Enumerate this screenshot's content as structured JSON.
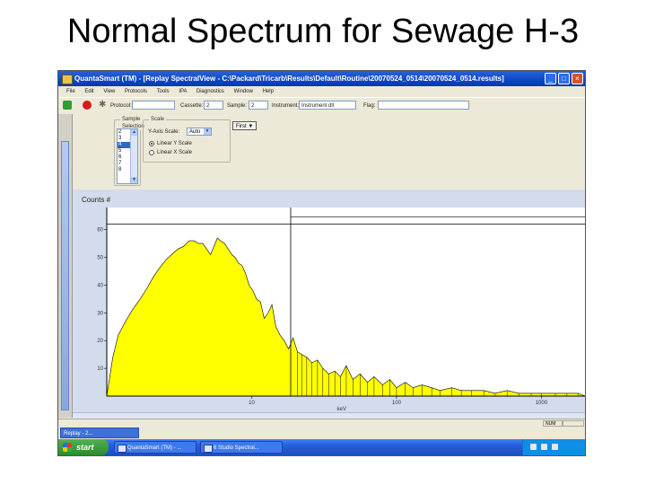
{
  "slide_title": "Normal Spectrum for Sewage H-3",
  "window": {
    "title": "QuantaSmart (TM) - [Replay SpectralView - C:\\Packard\\Tricarb\\Results\\Default\\Routine\\20070524_0514\\20070524_0514.results]"
  },
  "menu": [
    "File",
    "Edit",
    "View",
    "Protocols",
    "Tools",
    "IPA",
    "Diagnostics",
    "Window",
    "Help"
  ],
  "toolbar": {
    "protocol_label": "Protocol:",
    "cassette_label": "Cassette:",
    "cassette_value": "2",
    "sample_label": "Sample:",
    "sample_value": "2",
    "instrument_label": "Instrument:",
    "instrument_value": "Instrument dll",
    "flag_label": "Flag:"
  },
  "controls": {
    "sample_group_label": "Sample Selection",
    "sample_items": [
      "2",
      "3",
      "4",
      "5",
      "6",
      "7",
      "8"
    ],
    "sample_selected_index": 2,
    "scale_group_label": "Scale",
    "axis_label": "Y-Axis Scale:",
    "axis_value": "Auto",
    "linear_label": "Linear Y Scale",
    "log_label": "Linear X Scale",
    "first_button": "First"
  },
  "chart_data": {
    "type": "area",
    "ylabel": "Counts #",
    "xlabel": "keV",
    "y_ticks": [
      "60",
      "50",
      "40",
      "30",
      "20",
      "10"
    ],
    "x_ticks": [
      "10",
      "100",
      "1000"
    ],
    "x_scale": "log",
    "ylim": [
      0,
      68
    ],
    "color": "#ffff00",
    "cursor_keV": 18.6,
    "cursor_level": 62,
    "x": [
      1,
      1.1,
      1.2,
      1.35,
      1.5,
      1.7,
      1.9,
      2.1,
      2.3,
      2.55,
      2.8,
      3.1,
      3.4,
      3.7,
      4,
      4.3,
      4.6,
      4.9,
      5.2,
      5.5,
      5.8,
      6.1,
      6.5,
      6.9,
      7.3,
      7.7,
      8.1,
      8.6,
      9.1,
      9.6,
      10.2,
      10.8,
      11.5,
      12.2,
      13,
      13.8,
      14.7,
      15.7,
      16.8,
      18,
      19.3,
      20.7,
      22.2,
      24,
      26,
      28.5,
      31,
      34,
      37.5,
      41,
      45,
      50,
      56,
      63,
      70,
      80,
      90,
      100,
      115,
      130,
      150,
      175,
      200,
      240,
      280,
      330,
      400,
      480,
      580,
      700,
      850,
      1000,
      1250,
      1500,
      1800,
      2000
    ],
    "y": [
      0,
      14,
      22,
      27,
      31,
      35,
      39,
      43,
      46,
      49,
      51,
      53,
      54,
      56,
      56,
      55,
      55,
      53,
      51,
      54,
      57,
      56,
      55,
      53,
      51,
      50,
      48,
      47,
      44,
      40,
      38,
      35,
      34,
      28,
      30,
      33,
      25,
      22,
      20,
      17,
      21,
      16,
      15,
      14,
      12,
      13,
      10,
      8,
      9,
      7,
      11,
      6,
      8,
      5,
      7,
      4,
      6,
      3,
      5,
      3,
      4,
      3,
      2,
      3,
      2,
      2,
      2,
      1,
      2,
      1,
      1,
      1,
      1,
      1,
      1,
      0
    ]
  },
  "status": {
    "num": "NUM"
  },
  "replay_button": "Replay - 2...",
  "taskbar": {
    "start": "start",
    "items": [
      "QuantaSmart (TM) - ...",
      "6 Studio Spectral..."
    ],
    "time": ""
  }
}
